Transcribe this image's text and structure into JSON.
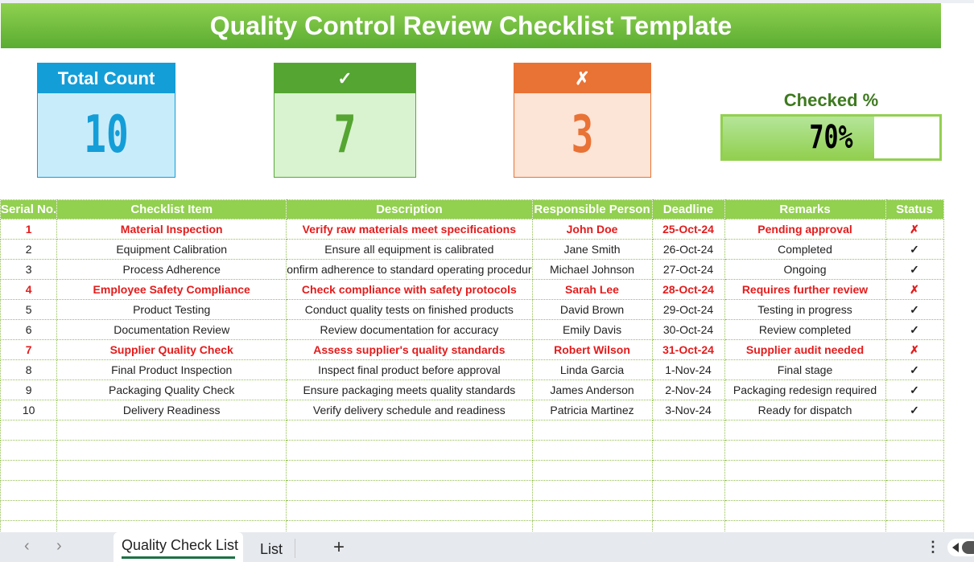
{
  "title": "Quality Control Review Checklist  Template",
  "kpis": {
    "total": {
      "label": "Total Count",
      "value": "10",
      "color": "#149ed8"
    },
    "checked": {
      "label": "✓",
      "icon": "check-icon",
      "value": "7",
      "color": "#54a531"
    },
    "unchecked": {
      "label": "✗",
      "icon": "cross-icon",
      "value": "3",
      "color": "#e97235"
    },
    "percent": {
      "label": "Checked %",
      "value_text": "70%",
      "fraction": 0.7
    }
  },
  "table": {
    "columns": [
      "Serial No.",
      "Checklist Item",
      "Description",
      "Responsible Person",
      "Deadline",
      "Remarks",
      "Status"
    ],
    "rows": [
      {
        "serial": "1",
        "item": "Material Inspection",
        "description": "Verify raw materials meet specifications",
        "person": "John Doe",
        "deadline": "25-Oct-24",
        "remarks": "Pending approval",
        "status": "✗",
        "flag": true
      },
      {
        "serial": "2",
        "item": "Equipment Calibration",
        "description": "Ensure all equipment is calibrated",
        "person": "Jane Smith",
        "deadline": "26-Oct-24",
        "remarks": "Completed",
        "status": "✓",
        "flag": false
      },
      {
        "serial": "3",
        "item": "Process Adherence",
        "description": "onfirm adherence to standard operating procedur",
        "person": "Michael Johnson",
        "deadline": "27-Oct-24",
        "remarks": "Ongoing",
        "status": "✓",
        "flag": false
      },
      {
        "serial": "4",
        "item": "Employee Safety Compliance",
        "description": "Check compliance with safety protocols",
        "person": "Sarah Lee",
        "deadline": "28-Oct-24",
        "remarks": "Requires further review",
        "status": "✗",
        "flag": true
      },
      {
        "serial": "5",
        "item": "Product Testing",
        "description": "Conduct quality tests on finished products",
        "person": "David Brown",
        "deadline": "29-Oct-24",
        "remarks": "Testing in progress",
        "status": "✓",
        "flag": false
      },
      {
        "serial": "6",
        "item": "Documentation Review",
        "description": "Review documentation for accuracy",
        "person": "Emily Davis",
        "deadline": "30-Oct-24",
        "remarks": "Review completed",
        "status": "✓",
        "flag": false
      },
      {
        "serial": "7",
        "item": "Supplier Quality Check",
        "description": "Assess supplier's quality standards",
        "person": "Robert Wilson",
        "deadline": "31-Oct-24",
        "remarks": "Supplier audit needed",
        "status": "✗",
        "flag": true
      },
      {
        "serial": "8",
        "item": "Final Product Inspection",
        "description": "Inspect final product before approval",
        "person": "Linda Garcia",
        "deadline": "1-Nov-24",
        "remarks": "Final stage",
        "status": "✓",
        "flag": false
      },
      {
        "serial": "9",
        "item": "Packaging Quality Check",
        "description": "Ensure packaging meets quality standards",
        "person": "James Anderson",
        "deadline": "2-Nov-24",
        "remarks": "Packaging redesign required",
        "status": "✓",
        "flag": false
      },
      {
        "serial": "10",
        "item": "Delivery Readiness",
        "description": "Verify delivery schedule and readiness",
        "person": "Patricia Martinez",
        "deadline": "3-Nov-24",
        "remarks": "Ready for dispatch",
        "status": "✓",
        "flag": false
      }
    ],
    "empty_rows": 6
  },
  "sheet_tabs": {
    "prev": "‹",
    "next": "›",
    "tabs": [
      {
        "label": "Quality Check List",
        "active": true
      },
      {
        "label": "List",
        "active": false
      }
    ],
    "add": "+",
    "more": "⋮"
  },
  "colors": {
    "header_green": "#92d050",
    "flag_red": "#e31c1c",
    "ok_green": "#1e9e45"
  }
}
